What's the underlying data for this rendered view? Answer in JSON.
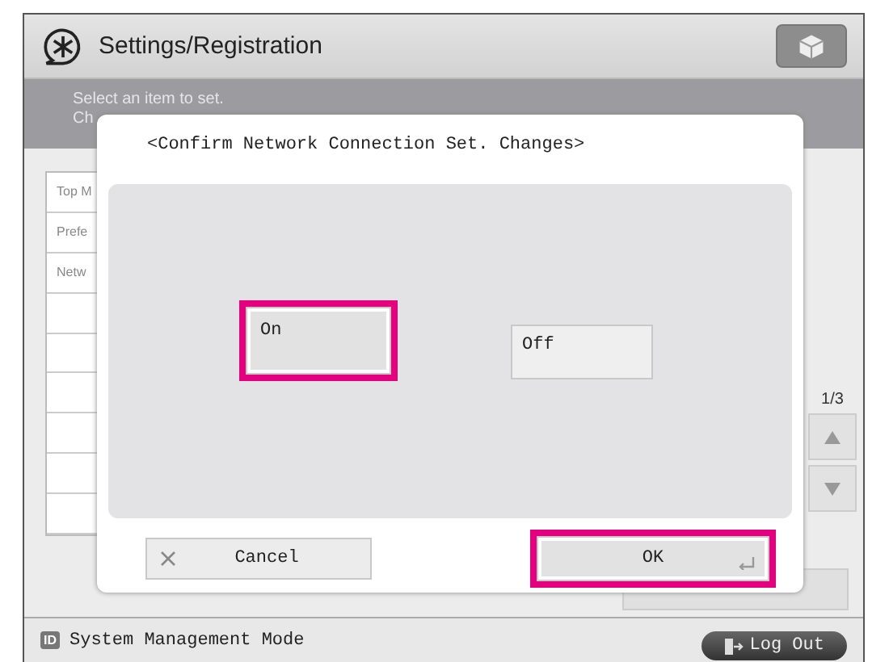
{
  "header": {
    "title": "Settings/Registration"
  },
  "instruction": {
    "lines": [
      "Select an item to set.",
      "Ch"
    ]
  },
  "list": {
    "items": [
      "Top M",
      "Prefe",
      "Netw"
    ]
  },
  "pager": {
    "page": "1/3"
  },
  "dialog": {
    "title": "<Confirm Network Connection Set. Changes>",
    "options": [
      {
        "label": "On",
        "selected": true,
        "highlighted": true
      },
      {
        "label": "Off",
        "selected": false,
        "highlighted": false
      }
    ],
    "buttons": [
      {
        "kind": "cancel",
        "label": "Cancel",
        "highlighted": false
      },
      {
        "kind": "ok",
        "label": "OK",
        "highlighted": true
      }
    ]
  },
  "footer": {
    "badge": "ID",
    "mode": "System Management Mode",
    "logout": "Log Out"
  }
}
